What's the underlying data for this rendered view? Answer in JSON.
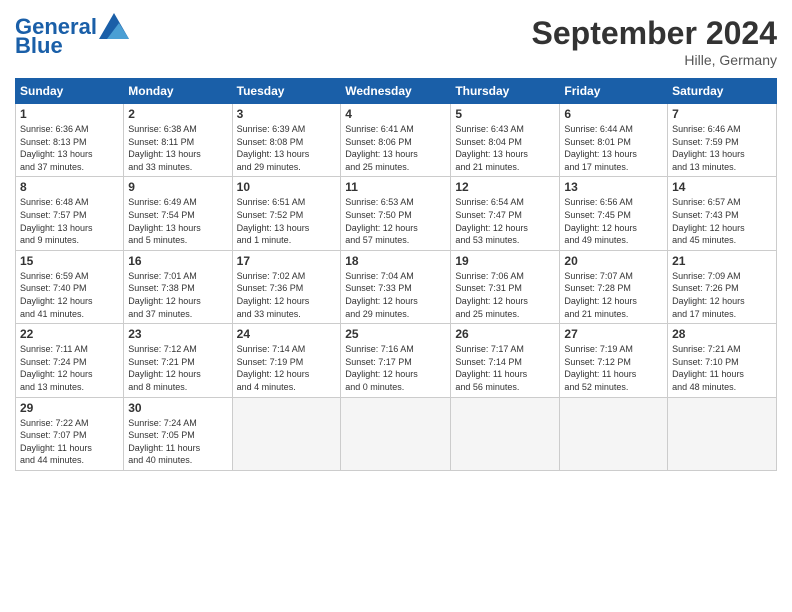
{
  "header": {
    "logo_general": "General",
    "logo_blue": "Blue",
    "month_title": "September 2024",
    "subtitle": "Hille, Germany"
  },
  "weekdays": [
    "Sunday",
    "Monday",
    "Tuesday",
    "Wednesday",
    "Thursday",
    "Friday",
    "Saturday"
  ],
  "days": [
    {
      "num": "",
      "info": ""
    },
    {
      "num": "2",
      "info": "Sunrise: 6:38 AM\nSunset: 8:11 PM\nDaylight: 13 hours\nand 33 minutes."
    },
    {
      "num": "3",
      "info": "Sunrise: 6:39 AM\nSunset: 8:08 PM\nDaylight: 13 hours\nand 29 minutes."
    },
    {
      "num": "4",
      "info": "Sunrise: 6:41 AM\nSunset: 8:06 PM\nDaylight: 13 hours\nand 25 minutes."
    },
    {
      "num": "5",
      "info": "Sunrise: 6:43 AM\nSunset: 8:04 PM\nDaylight: 13 hours\nand 21 minutes."
    },
    {
      "num": "6",
      "info": "Sunrise: 6:44 AM\nSunset: 8:01 PM\nDaylight: 13 hours\nand 17 minutes."
    },
    {
      "num": "7",
      "info": "Sunrise: 6:46 AM\nSunset: 7:59 PM\nDaylight: 13 hours\nand 13 minutes."
    },
    {
      "num": "8",
      "info": "Sunrise: 6:48 AM\nSunset: 7:57 PM\nDaylight: 13 hours\nand 9 minutes."
    },
    {
      "num": "9",
      "info": "Sunrise: 6:49 AM\nSunset: 7:54 PM\nDaylight: 13 hours\nand 5 minutes."
    },
    {
      "num": "10",
      "info": "Sunrise: 6:51 AM\nSunset: 7:52 PM\nDaylight: 13 hours\nand 1 minute."
    },
    {
      "num": "11",
      "info": "Sunrise: 6:53 AM\nSunset: 7:50 PM\nDaylight: 12 hours\nand 57 minutes."
    },
    {
      "num": "12",
      "info": "Sunrise: 6:54 AM\nSunset: 7:47 PM\nDaylight: 12 hours\nand 53 minutes."
    },
    {
      "num": "13",
      "info": "Sunrise: 6:56 AM\nSunset: 7:45 PM\nDaylight: 12 hours\nand 49 minutes."
    },
    {
      "num": "14",
      "info": "Sunrise: 6:57 AM\nSunset: 7:43 PM\nDaylight: 12 hours\nand 45 minutes."
    },
    {
      "num": "15",
      "info": "Sunrise: 6:59 AM\nSunset: 7:40 PM\nDaylight: 12 hours\nand 41 minutes."
    },
    {
      "num": "16",
      "info": "Sunrise: 7:01 AM\nSunset: 7:38 PM\nDaylight: 12 hours\nand 37 minutes."
    },
    {
      "num": "17",
      "info": "Sunrise: 7:02 AM\nSunset: 7:36 PM\nDaylight: 12 hours\nand 33 minutes."
    },
    {
      "num": "18",
      "info": "Sunrise: 7:04 AM\nSunset: 7:33 PM\nDaylight: 12 hours\nand 29 minutes."
    },
    {
      "num": "19",
      "info": "Sunrise: 7:06 AM\nSunset: 7:31 PM\nDaylight: 12 hours\nand 25 minutes."
    },
    {
      "num": "20",
      "info": "Sunrise: 7:07 AM\nSunset: 7:28 PM\nDaylight: 12 hours\nand 21 minutes."
    },
    {
      "num": "21",
      "info": "Sunrise: 7:09 AM\nSunset: 7:26 PM\nDaylight: 12 hours\nand 17 minutes."
    },
    {
      "num": "22",
      "info": "Sunrise: 7:11 AM\nSunset: 7:24 PM\nDaylight: 12 hours\nand 13 minutes."
    },
    {
      "num": "23",
      "info": "Sunrise: 7:12 AM\nSunset: 7:21 PM\nDaylight: 12 hours\nand 8 minutes."
    },
    {
      "num": "24",
      "info": "Sunrise: 7:14 AM\nSunset: 7:19 PM\nDaylight: 12 hours\nand 4 minutes."
    },
    {
      "num": "25",
      "info": "Sunrise: 7:16 AM\nSunset: 7:17 PM\nDaylight: 12 hours\nand 0 minutes."
    },
    {
      "num": "26",
      "info": "Sunrise: 7:17 AM\nSunset: 7:14 PM\nDaylight: 11 hours\nand 56 minutes."
    },
    {
      "num": "27",
      "info": "Sunrise: 7:19 AM\nSunset: 7:12 PM\nDaylight: 11 hours\nand 52 minutes."
    },
    {
      "num": "28",
      "info": "Sunrise: 7:21 AM\nSunset: 7:10 PM\nDaylight: 11 hours\nand 48 minutes."
    },
    {
      "num": "29",
      "info": "Sunrise: 7:22 AM\nSunset: 7:07 PM\nDaylight: 11 hours\nand 44 minutes."
    },
    {
      "num": "30",
      "info": "Sunrise: 7:24 AM\nSunset: 7:05 PM\nDaylight: 11 hours\nand 40 minutes."
    },
    {
      "num": "",
      "info": ""
    },
    {
      "num": "",
      "info": ""
    },
    {
      "num": "",
      "info": ""
    },
    {
      "num": "",
      "info": ""
    },
    {
      "num": "",
      "info": ""
    }
  ],
  "day1": {
    "num": "1",
    "info": "Sunrise: 6:36 AM\nSunset: 8:13 PM\nDaylight: 13 hours\nand 37 minutes."
  }
}
